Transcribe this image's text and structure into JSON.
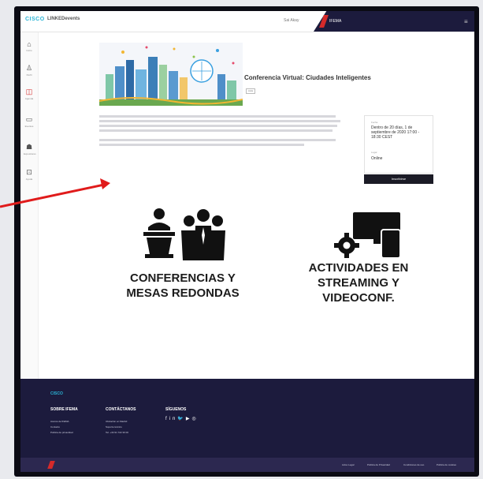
{
  "header": {
    "brand": "CISCO",
    "brand_secondary": "LINKEDevents",
    "user": "Sai Akay",
    "ifema_mini": "IFEMA"
  },
  "sidebar": {
    "items": [
      {
        "label": "Inicio",
        "icon": "home-icon"
      },
      {
        "label": "Perfil",
        "icon": "user-icon"
      },
      {
        "label": "Agenda",
        "icon": "calendar-icon"
      },
      {
        "label": "Eventos",
        "icon": "screen-icon"
      },
      {
        "label": "Expositores",
        "icon": "people-icon"
      },
      {
        "label": "Ayuda",
        "icon": "help-icon"
      }
    ]
  },
  "event": {
    "title": "Conferencia Virtual: Ciudades Inteligentes",
    "tag": "Aula",
    "info": {
      "date_label": "Fecha",
      "date_value": "Dentro de 20 días, 1 de septiembre de 2020 17:00 - 18:30 CEST",
      "location_label": "Lugar",
      "location_value": "Online"
    },
    "button_label": "Inscribirse"
  },
  "features": [
    {
      "label": "CONFERENCIAS Y MESAS REDONDAS",
      "icon": "conference-icon"
    },
    {
      "label": "ACTIVIDADES EN STREAMING Y VIDEOCONF.",
      "icon": "streaming-icon"
    }
  ],
  "footer": {
    "brand": "CISCO",
    "col1": {
      "title": "SOBRE IFEMA",
      "links": [
        "Acerca de IFEMA",
        "Contacto",
        "Política de privacidad"
      ]
    },
    "col2": {
      "title": "CONTÁCTANOS",
      "links": [
        "Ubicación en Madrid",
        "Soporte técnico",
        "Tel. +34 91 722 30 00"
      ]
    },
    "col3": {
      "title": "SÍGUENOS"
    },
    "bottom_links": [
      "Aviso Legal",
      "Política de Privacidad",
      "Condiciones de uso",
      "Política de cookies"
    ]
  },
  "colors": {
    "navy": "#1c1b3d",
    "accent_red": "#d52a2a",
    "brand_cyan": "#2ab4d6"
  }
}
